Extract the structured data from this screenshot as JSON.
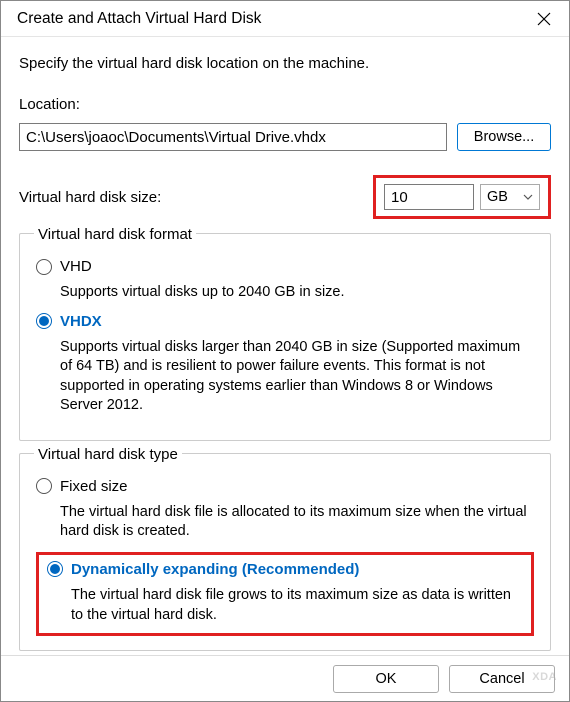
{
  "titlebar": {
    "title": "Create and Attach Virtual Hard Disk"
  },
  "instruction": "Specify the virtual hard disk location on the machine.",
  "location": {
    "label": "Location:",
    "value": "C:\\Users\\joaoc\\Documents\\Virtual Drive.vhdx",
    "browse": "Browse..."
  },
  "size": {
    "label": "Virtual hard disk size:",
    "value": "10",
    "unit": "GB"
  },
  "format": {
    "legend": "Virtual hard disk format",
    "vhd": {
      "label": "VHD",
      "desc": "Supports virtual disks up to 2040 GB in size."
    },
    "vhdx": {
      "label": "VHDX",
      "desc": "Supports virtual disks larger than 2040 GB in size (Supported maximum of 64 TB) and is resilient to power failure events. This format is not supported in operating systems earlier than Windows 8 or Windows Server 2012."
    }
  },
  "type": {
    "legend": "Virtual hard disk type",
    "fixed": {
      "label": "Fixed size",
      "desc": "The virtual hard disk file is allocated to its maximum size when the virtual hard disk is created."
    },
    "dynamic": {
      "label": "Dynamically expanding (Recommended)",
      "desc": "The virtual hard disk file grows to its maximum size as data is written to the virtual hard disk."
    }
  },
  "footer": {
    "ok": "OK",
    "cancel": "Cancel"
  },
  "watermark": "XDA"
}
